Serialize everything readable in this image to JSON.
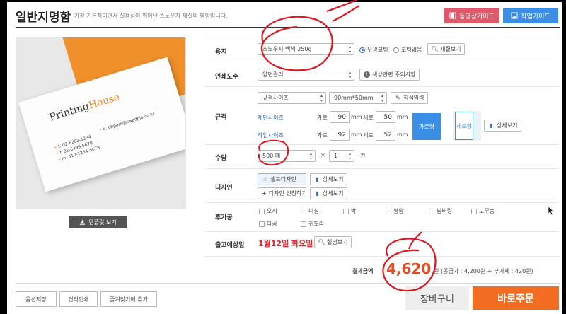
{
  "header": {
    "title": "일반지명함",
    "description": "가장 기본적이면서 실용성이 뛰어난 스노우지 재질의 명함입니다.",
    "video_guide": "동영상가이드",
    "work_guide": "작업가이드"
  },
  "preview": {
    "card_brand_1": "Printing",
    "card_brand_2": "House",
    "card_email": "e. dhpark@swadpia.co.kr",
    "card_phone_t": "t. 02-6262-1234",
    "card_phone_f": "f. 02-6499-5678",
    "card_phone_m": "m. 010-1234-5678",
    "template_button": "템플릿 보기"
  },
  "options": {
    "paper": {
      "label": "용지",
      "select_value": "스노우지 백색 250g",
      "radio_coating_on": "무광코팅",
      "radio_coating_off": "코팅없음",
      "material_button": "재질보기"
    },
    "print_colors": {
      "label": "인쇄도수",
      "select_value": "양면컬러",
      "caution_button": "색상관련 주의사항"
    },
    "size": {
      "label": "규격",
      "select_type": "규격사이즈",
      "select_size": "90mm*50mm",
      "direct_input_button": "직접입력",
      "cut_size_link": "재단사이즈",
      "work_size_link": "작업사이즈",
      "width_label": "가로",
      "height_label": "세로",
      "unit": "mm",
      "cut_width": "90",
      "cut_height": "50",
      "work_width": "92",
      "work_height": "52",
      "horizontal": "가로형",
      "vertical": "세로형",
      "detail_button": "상세보기"
    },
    "quantity": {
      "label": "수량",
      "select_value": "500 매",
      "times": "×",
      "count_value": "1",
      "unit": "건"
    },
    "design": {
      "label": "디자인",
      "self_design": "셀프디자인",
      "design_request": "디자인 신청하기",
      "detail_button_1": "상세보기",
      "detail_button_2": "상세보기"
    },
    "post_processing": {
      "label": "후가공",
      "items": [
        "오시",
        "미싱",
        "박",
        "형압",
        "넘버링",
        "도무송",
        "타공",
        "귀도리"
      ]
    },
    "shipping": {
      "label": "출고예상일",
      "date": "1월12일  화요일",
      "explain_button": "설명보기"
    }
  },
  "total": {
    "label": "결제금액",
    "amount": "4,620",
    "won": "원",
    "detail": "(공급가 : 4,200원 + 부가세 : 420원)"
  },
  "footer": {
    "save_options": "옵션저장",
    "estimate_print": "견적인쇄",
    "add_favorite": "즐겨찾기에 추가",
    "cart": "장바구니",
    "order_now": "바로주문"
  },
  "colors": {
    "accent_blue": "#3a8ee6",
    "video_red": "#e15869",
    "order_orange": "#f26d21",
    "price_red": "#e24b24",
    "annotation_red": "#e0141e"
  }
}
